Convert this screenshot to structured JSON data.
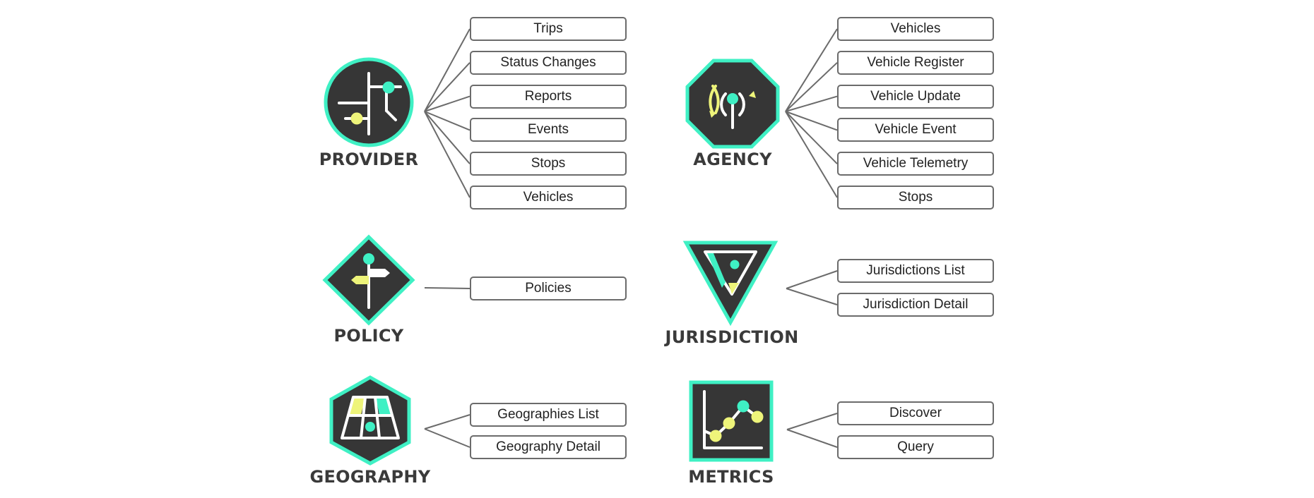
{
  "colors": {
    "icon_bg": "#363636",
    "accent_teal": "#3ff0c4",
    "accent_yellow": "#eef47a",
    "line": "#6b6b6b",
    "label": "#3a3a3a"
  },
  "groups": [
    {
      "id": "provider",
      "label": "PROVIDER",
      "icon": "provider-network-icon",
      "items": [
        "Trips",
        "Status Changes",
        "Reports",
        "Events",
        "Stops",
        "Vehicles"
      ]
    },
    {
      "id": "agency",
      "label": "AGENCY",
      "icon": "agency-antenna-icon",
      "items": [
        "Vehicles",
        "Vehicle Register",
        "Vehicle Update",
        "Vehicle Event",
        "Vehicle Telemetry",
        "Stops"
      ]
    },
    {
      "id": "policy",
      "label": "POLICY",
      "icon": "policy-signpost-icon",
      "items": [
        "Policies"
      ]
    },
    {
      "id": "jurisdiction",
      "label": "JURISDICTION",
      "icon": "jurisdiction-triangle-icon",
      "items": [
        "Jurisdictions List",
        "Jurisdiction Detail"
      ]
    },
    {
      "id": "geography",
      "label": "GEOGRAPHY",
      "icon": "geography-map-icon",
      "items": [
        "Geographies List",
        "Geography Detail"
      ]
    },
    {
      "id": "metrics",
      "label": "METRICS",
      "icon": "metrics-chart-icon",
      "items": [
        "Discover",
        "Query"
      ]
    }
  ]
}
